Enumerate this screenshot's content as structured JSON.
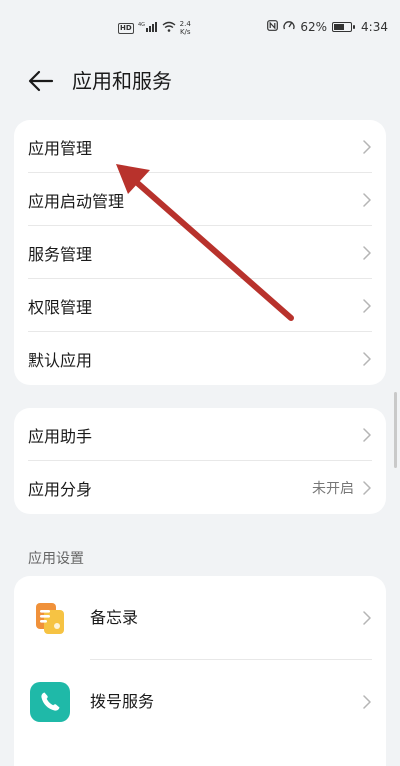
{
  "status_bar": {
    "hd_badge": "HD",
    "network": "4G",
    "speed_value": "2.4",
    "speed_unit": "K/s",
    "battery": "62%",
    "battery_level": 0.62,
    "time": "4:34"
  },
  "header": {
    "back_icon": "arrow-left-icon",
    "title": "应用和服务"
  },
  "group1": {
    "items": [
      {
        "label": "应用管理"
      },
      {
        "label": "应用启动管理"
      },
      {
        "label": "服务管理"
      },
      {
        "label": "权限管理"
      },
      {
        "label": "默认应用"
      }
    ]
  },
  "group2": {
    "items": [
      {
        "label": "应用助手",
        "value": ""
      },
      {
        "label": "应用分身",
        "value": "未开启"
      }
    ]
  },
  "section_app_settings": {
    "title": "应用设置",
    "items": [
      {
        "label": "备忘录",
        "icon": "notepad-icon",
        "icon_color": "#f0913a"
      },
      {
        "label": "拨号服务",
        "icon": "phone-icon",
        "icon_color": "#1fb9a8"
      }
    ]
  },
  "annotation": {
    "arrow_color": "#b8322c"
  }
}
